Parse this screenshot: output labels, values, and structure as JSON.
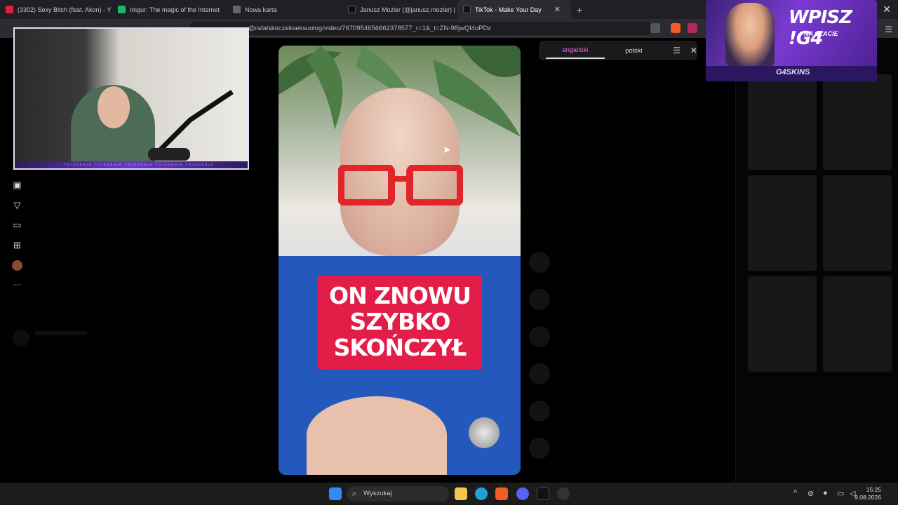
{
  "tabs": [
    {
      "label": "(3302) Sexy Bitch (feat. Akon) - Y",
      "favicon_color": "#e11d48"
    },
    {
      "label": "Imgur: The magic of the Internet",
      "favicon_color": "#1bb76e"
    },
    {
      "label": "Nowa karta",
      "favicon_color": "#888888"
    },
    {
      "label": "Janusz Mozler (@janusz.mozler) | Tik",
      "favicon_color": "#000000"
    },
    {
      "label": "TikTok - Make Your Day",
      "favicon_color": "#000000",
      "active": true
    }
  ],
  "address": {
    "url": "@rafalskoczekseksuolog/video/7670954656662378577_r=1&_t=ZN-98jwQl4oPDz"
  },
  "translate_popup": {
    "languages": [
      "angielski",
      "polski"
    ],
    "active": "angielski"
  },
  "video": {
    "caption_lines": [
      "ON ZNOWU",
      "SZYBKO",
      "SKOŃCZYŁ"
    ]
  },
  "banner": {
    "title": "WPISZ !G4",
    "subtitle": "NA CZACIE",
    "brand": "G4SKINS"
  },
  "webcam": {
    "bar_text": "TOJADENIE TOJADENIE TOJADENIE TOJADENIE TOJADENIE"
  },
  "taskbar": {
    "search_placeholder": "Wyszukaj",
    "time": "15:25",
    "date": "9.08.2026"
  },
  "colors": {
    "accent": "#f06bdc",
    "caption_bg": "#e11d48"
  }
}
